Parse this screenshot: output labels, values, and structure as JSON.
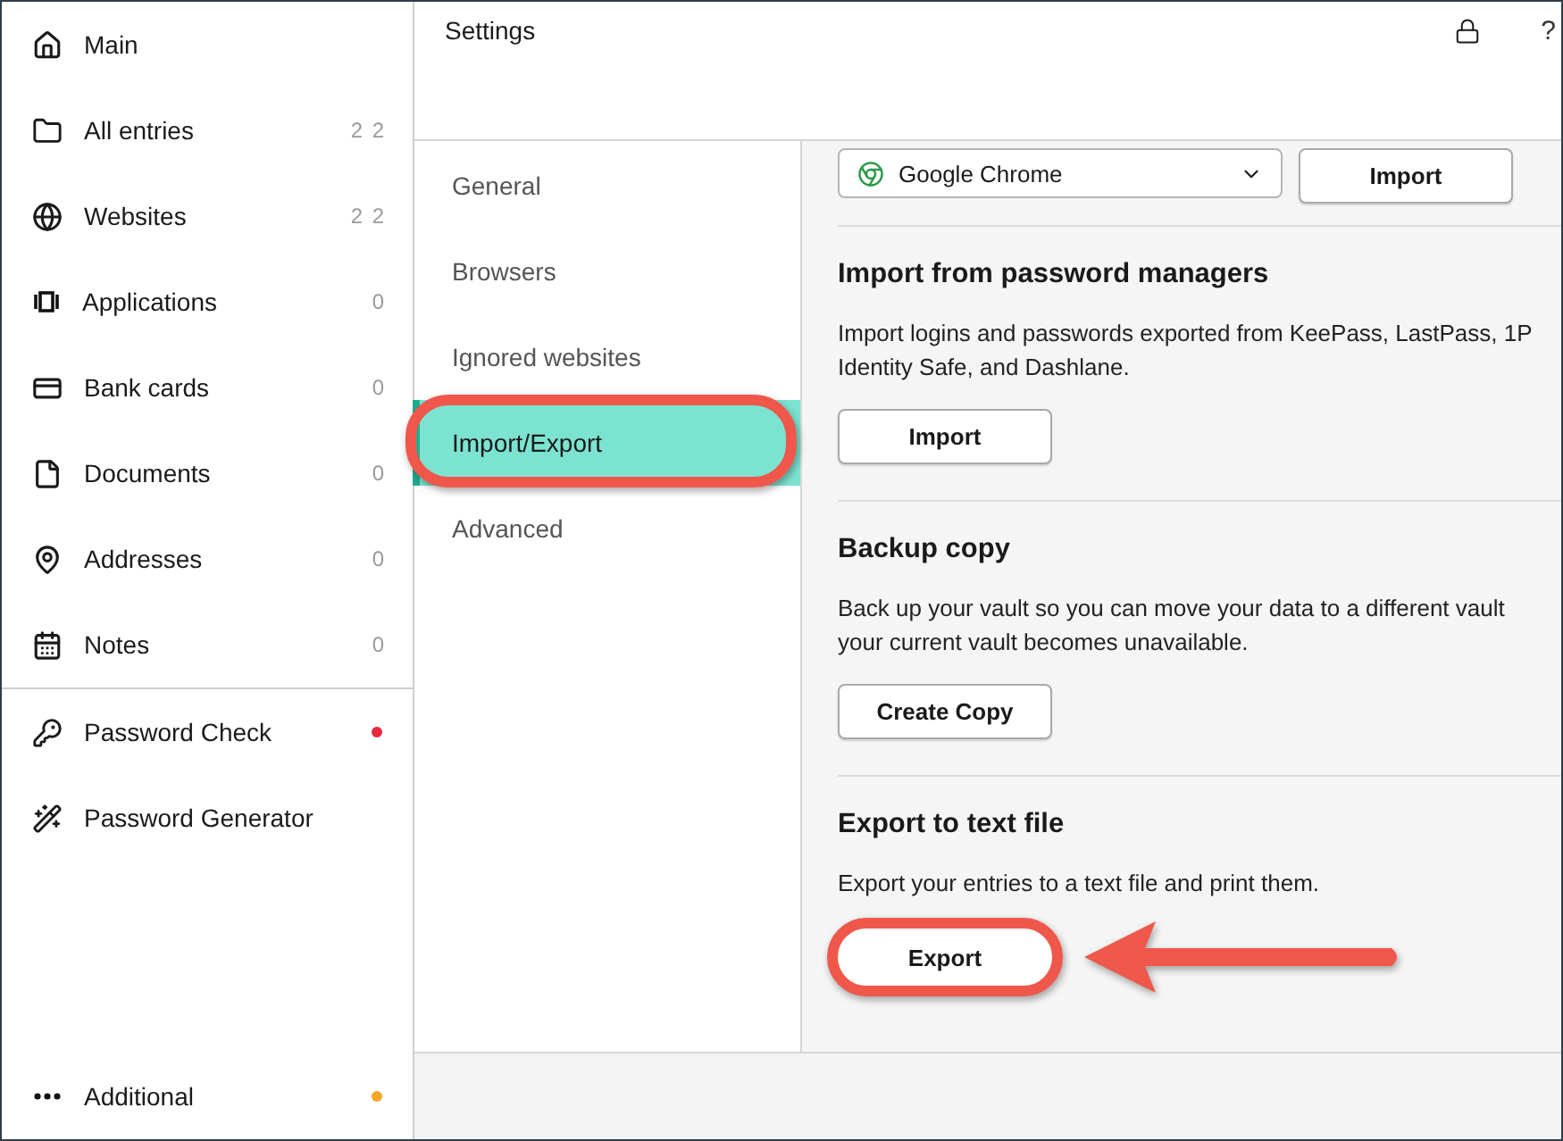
{
  "sidebar": {
    "categories": [
      {
        "label": "Main",
        "kind": "plain"
      },
      {
        "label": "All entries",
        "kind": "count",
        "count": "2 2"
      },
      {
        "label": "Websites",
        "kind": "count",
        "count": "2 2"
      },
      {
        "label": "Applications",
        "kind": "count",
        "count": "0"
      },
      {
        "label": "Bank cards",
        "kind": "count",
        "count": "0"
      },
      {
        "label": "Documents",
        "kind": "count",
        "count": "0"
      },
      {
        "label": "Addresses",
        "kind": "count",
        "count": "0"
      },
      {
        "label": "Notes",
        "kind": "count",
        "count": "0"
      }
    ],
    "tools": [
      {
        "label": "Password Check",
        "kind": "dot",
        "color": "#e8283c"
      },
      {
        "label": "Password Generator",
        "kind": "plain"
      }
    ],
    "footer": {
      "label": "Additional",
      "kind": "dot",
      "color": "#f5a623"
    }
  },
  "header": {
    "title": "Settings",
    "help": "?"
  },
  "settings_nav": [
    {
      "label": "General",
      "selected": false
    },
    {
      "label": "Browsers",
      "selected": false
    },
    {
      "label": "Ignored websites",
      "selected": false
    },
    {
      "label": "Import/Export",
      "selected": true
    },
    {
      "label": "Advanced",
      "selected": false
    }
  ],
  "browser_import": {
    "browser": "Google Chrome",
    "button": "Import"
  },
  "sections": [
    {
      "title": "Import from password managers",
      "description": "Import logins and passwords exported from KeePass, LastPass, 1P\nIdentity Safe, and Dashlane.",
      "button": "Import",
      "highlighted": false
    },
    {
      "title": "Backup copy",
      "description": "Back up your vault so you can move your data to a different vault\nyour current vault becomes unavailable.",
      "button": "Create Copy",
      "highlighted": false
    },
    {
      "title": "Export to text file",
      "description": "Export your entries to a text file and print them.",
      "button": "Export",
      "highlighted": true
    }
  ]
}
